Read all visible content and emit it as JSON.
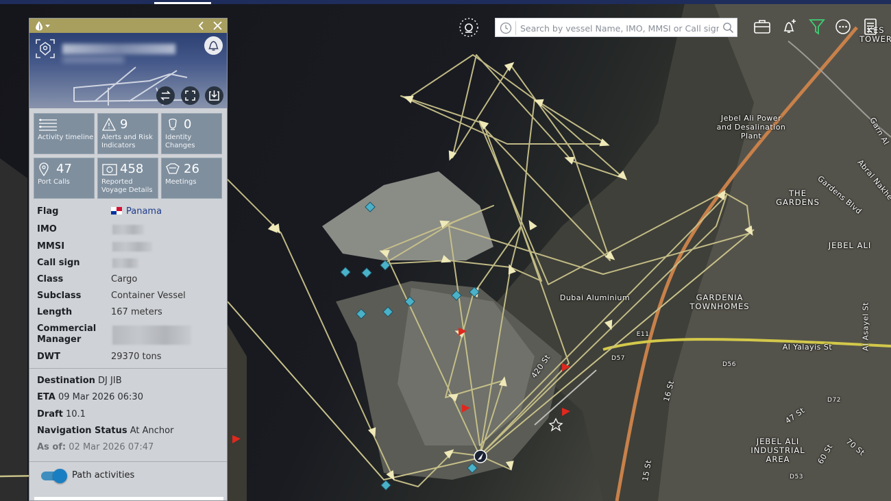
{
  "search": {
    "placeholder": "Search by vessel Name, IMO, MMSI or Call sign"
  },
  "toolbar": {
    "icons": [
      "sun-icon",
      "clock-icon",
      "search-icon",
      "briefcase-icon",
      "bell-plus-icon",
      "filter-icon",
      "more-icon",
      "document-icon"
    ]
  },
  "panel": {
    "tiles": [
      {
        "num": "",
        "label": "Activity timeline",
        "icon": "timeline-icon"
      },
      {
        "num": "9",
        "label": "Alerts and Risk Indicators",
        "icon": "warning-icon"
      },
      {
        "num": "0",
        "label": "Identity Changes",
        "icon": "identity-icon"
      },
      {
        "num": "47",
        "label": "Port Calls",
        "icon": "location-pin-icon"
      },
      {
        "num": "458",
        "label": "Reported Voyage Details",
        "icon": "voyage-icon"
      },
      {
        "num": "26",
        "label": "Meetings",
        "icon": "meeting-icon"
      }
    ],
    "details": {
      "flag_label": "Flag",
      "flag_value": "Panama",
      "imo_label": "IMO",
      "mmsi_label": "MMSI",
      "callsign_label": "Call sign",
      "class_label": "Class",
      "class_value": "Cargo",
      "subclass_label": "Subclass",
      "subclass_value": "Container Vessel",
      "length_label": "Length",
      "length_value": "167 meters",
      "manager_label_1": "Commercial",
      "manager_label_2": "Manager",
      "dwt_label": "DWT",
      "dwt_value": "29370 tons"
    },
    "voyage": {
      "destination_label": "Destination",
      "destination_value": "DJ JIB",
      "eta_label": "ETA",
      "eta_value": "09 Mar 2026 06:30",
      "draft_label": "Draft",
      "draft_value": "10.1",
      "nav_status_label": "Navigation Status",
      "nav_status_value": "At Anchor",
      "as_of_label": "As of:",
      "as_of_value": "02 Mar 2026 07:47"
    },
    "path_activities_label": "Path activities",
    "path_activities_on": true
  },
  "map_labels": {
    "power_plant": [
      "Jebel Ali Power",
      "and Desalination",
      "Plant"
    ],
    "the_gardens": [
      "THE",
      "GARDENS"
    ],
    "jebel_ali": "JEBEL ALI",
    "gardenia": [
      "GARDENIA",
      "TOWNHOMES"
    ],
    "dubai_aluminium": "Dubai Aluminium",
    "al_yalayis": "Al Yalayis St",
    "industrial": [
      "JEBEL ALI",
      "INDUSTRIAL",
      "AREA"
    ],
    "st_420": "420 St",
    "st_16": "16 St",
    "st_47": "47 St",
    "st_70": "70 St",
    "st_60": "60 St",
    "st_15": "15 St",
    "garn_al": "Garn Al",
    "gardens_blvd": "Gardens Blvd",
    "abral_nakhe": "Abral Nakhe",
    "al_asayel": "Al Asayel St",
    "tower": [
      "KES",
      "TOWER"
    ],
    "e11": "E11",
    "d57": "D57",
    "d56": "D56",
    "d72": "D72",
    "d53": "D53"
  },
  "colors": {
    "path": "#c9c28a",
    "accent_bar": "#a89e5e",
    "tile_bg": "#7f8f9e",
    "toggle": "#1a7fc2"
  }
}
